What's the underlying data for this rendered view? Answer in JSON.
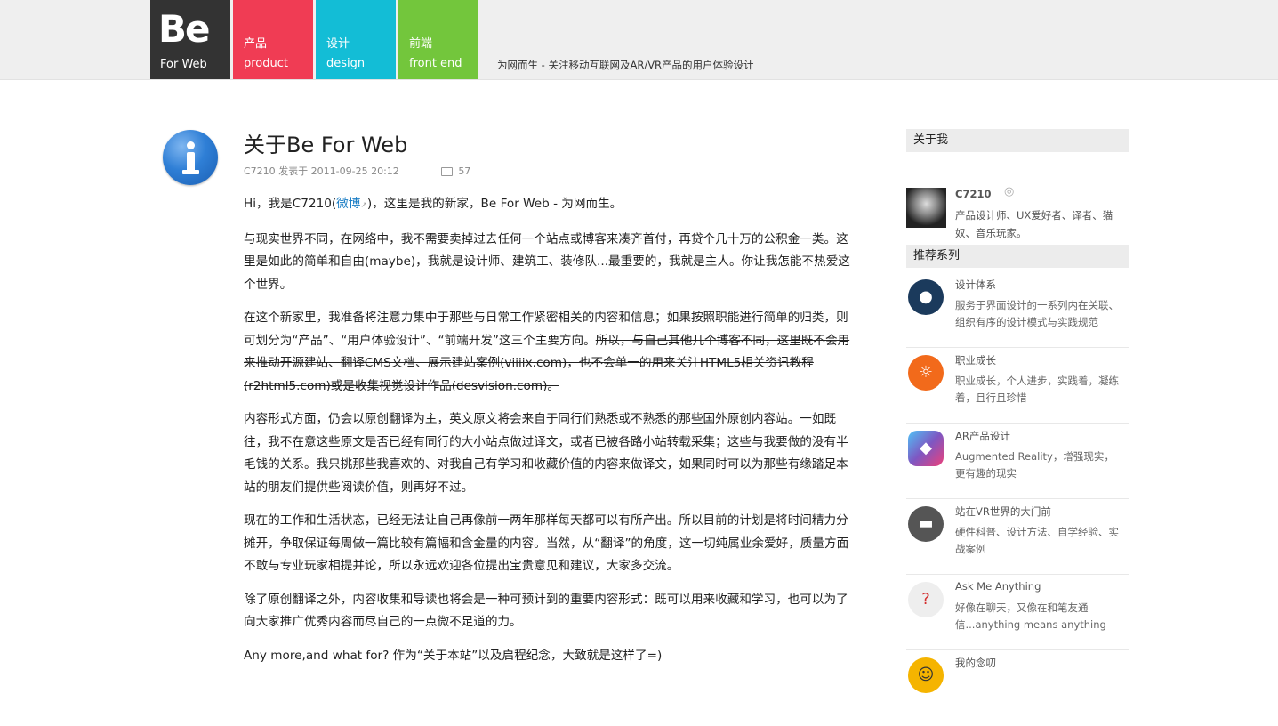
{
  "header": {
    "logo_big": "Be",
    "logo_small": "For Web",
    "nav": [
      {
        "zh": "产品",
        "en": "product",
        "color": "#f03c54"
      },
      {
        "zh": "设计",
        "en": "design",
        "color": "#13bdd6"
      },
      {
        "zh": "前端",
        "en": "front end",
        "color": "#73c63c"
      }
    ],
    "slogan": "为网而生 - 关注移动互联网及AR/VR产品的用户体验设计"
  },
  "post": {
    "title": "关于Be For Web",
    "author": "C7210",
    "date_text": "发表于 2011-09-25 20:12",
    "comments": "57",
    "p1_a": "Hi，我是C7210(",
    "p1_link": "微博",
    "p1_b": ")，这里是我的新家，Be For Web - 为网而生。",
    "p2": "与现实世界不同，在网络中，我不需要卖掉过去任何一个站点或博客来凑齐首付，再贷个几十万的公积金一类。这里是如此的简单和自由(maybe)，我就是设计师、建筑工、装修队...最重要的，我就是主人。你让我怎能不热爱这个世界。",
    "p3_a": "在这个新家里，我准备将注意力集中于那些与日常工作紧密相关的内容和信息；如果按照职能进行简单的归类，则可划分为“产品”、“用户体验设计”、“前端开发”这三个主要方向。",
    "p3_strike": "所以，与自己其他几个博客不同，这里既不会用来推动开源建站、翻译CMS文档、展示建站案例(viiiix.com)，也不会单一的用来关注HTML5相关资讯教程(r2html5.com)或是收集视觉设计作品(desvision.com)。",
    "p4": "内容形式方面，仍会以原创翻译为主，英文原文将会来自于同行们熟悉或不熟悉的那些国外原创内容站。一如既往，我不在意这些原文是否已经有同行的大小站点做过译文，或者已被各路小站转载采集；这些与我要做的没有半毛钱的关系。我只挑那些我喜欢的、对我自己有学习和收藏价值的内容来做译文，如果同时可以为那些有缘踏足本站的朋友们提供些阅读价值，则再好不过。",
    "p5": "现在的工作和生活状态，已经无法让自己再像前一两年那样每天都可以有所产出。所以目前的计划是将时间精力分摊开，争取保证每周做一篇比较有篇幅和含金量的内容。当然，从“翻译”的角度，这一切纯属业余爱好，质量方面不敢与专业玩家相提并论，所以永远欢迎各位提出宝贵意见和建议，大家多交流。",
    "p6": "除了原创翻译之外，内容收集和导读也将会是一种可预计到的重要内容形式：既可以用来收藏和学习，也可以为了向大家推广优秀内容而尽自己的一点微不足道的力。",
    "p7": "Any more,and what for? 作为“关于本站”以及启程纪念，大致就是这样了=)"
  },
  "sidebar": {
    "about_title": "关于我",
    "about_name": "C7210",
    "about_desc": "产品设计师、UX爱好者、译者、猫奴、音乐玩家。",
    "rec_title": "推荐系列",
    "items": [
      {
        "name": "设计体系",
        "desc": "服务于界面设计的一系列内在关联、组织有序的设计模式与实践规范",
        "color": "#1b3a5c",
        "icon": "design-system-icon"
      },
      {
        "name": "职业成长",
        "desc": "职业成长，个人进步，实践着，凝练着，且行且珍惜",
        "color": "#f26a1b",
        "icon": "lightbulb-icon"
      },
      {
        "name": "AR产品设计",
        "desc": "Augmented Reality，增强现实，更有趣的现实",
        "color": "#5a7be0",
        "icon": "ar-cube-icon"
      },
      {
        "name": "站在VR世界的大门前",
        "desc": "硬件科普、设计方法、自学经验、实战案例",
        "color": "#555555",
        "icon": "vr-headset-icon"
      },
      {
        "name": "Ask Me Anything",
        "desc": "好像在聊天，又像在和笔友通信...anything means anything",
        "color": "#eeeeee",
        "icon": "people-question-icon"
      },
      {
        "name": "我的念叨",
        "desc": "",
        "color": "#f5b400",
        "icon": "smiley-icon"
      }
    ]
  }
}
